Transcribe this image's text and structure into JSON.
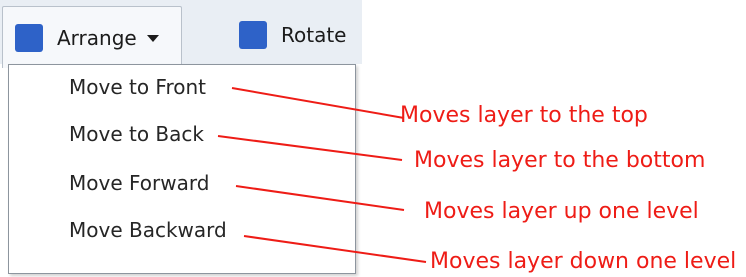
{
  "toolbar": {
    "arrange_label": "Arrange",
    "rotate_label": "Rotate",
    "icon_color": "#2e62c8"
  },
  "menu": {
    "items": [
      {
        "label": "Move to Front"
      },
      {
        "label": "Move to Back"
      },
      {
        "label": "Move Forward"
      },
      {
        "label": "Move Backward"
      }
    ]
  },
  "annotations": [
    {
      "text": "Moves layer to the top"
    },
    {
      "text": "Moves layer to the bottom"
    },
    {
      "text": "Moves layer up one level"
    },
    {
      "text": "Moves layer down one level"
    }
  ],
  "annotation_color": "#ee1c16"
}
